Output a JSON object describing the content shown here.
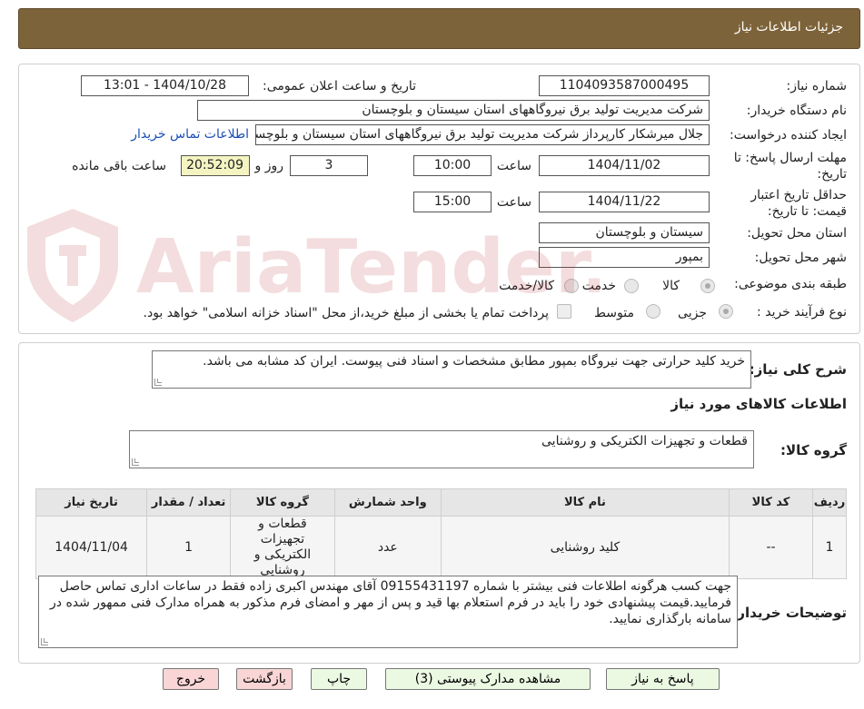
{
  "header": {
    "title": "جزئیات اطلاعات نیاز"
  },
  "need": {
    "number_label": "شماره نیاز:",
    "number_value": "1104093587000495",
    "announce_label": "تاریخ و ساعت اعلان عمومی:",
    "announce_value": "1404/10/28 - 13:01",
    "buyer_org_label": "نام دستگاه خریدار:",
    "buyer_org_value": "شرکت مدیریت تولید برق نیروگاههای استان سیستان و بلوچستان",
    "creator_label": "ایجاد کننده درخواست:",
    "creator_value": "جلال میرشکار کارپرداز شرکت مدیریت تولید برق نیروگاههای استان سیستان و بلوچستان",
    "contact_link": "اطلاعات تماس خریدار",
    "deadline_label_1": "مهلت ارسال پاسخ: تا",
    "deadline_label_2": "تاریخ:",
    "deadline_date": "1404/11/02",
    "time_label": "ساعت",
    "deadline_time": "10:00",
    "days_value": "3",
    "days_label": "روز و",
    "remaining_time": "20:52:09",
    "remaining_label": "ساعت باقی مانده",
    "validity_label_1": "حداقل تاریخ اعتبار",
    "validity_label_2": "قیمت: تا تاریخ:",
    "validity_date": "1404/11/22",
    "validity_time": "15:00",
    "province_label": "استان محل تحویل:",
    "province_value": "سیستان و بلوچستان",
    "city_label": "شهر محل تحویل:",
    "city_value": "بمپور",
    "category_label": "طبقه بندی موضوعی:",
    "category_options": [
      "کالا",
      "خدمت",
      "کالا/خدمت"
    ],
    "process_label": "نوع فرآیند خرید :",
    "process_options": [
      "جزیی",
      "متوسط"
    ],
    "treasury_text": "پرداخت تمام یا بخشی از مبلغ خرید،از محل \"اسناد خزانه اسلامی\" خواهد بود."
  },
  "description": {
    "label": "شرح کلی نیاز:",
    "value": "خرید کلید حرارتی جهت نیروگاه بمپور مطابق مشخصات و اسناد فنی پیوست. ایران کد مشابه می باشد."
  },
  "goods": {
    "section_title": "اطلاعات کالاهای مورد نیاز",
    "group_label": "گروه کالا:",
    "group_value": "قطعات و تجهیزات الکتریکی و روشنایی",
    "columns": [
      "ردیف",
      "کد کالا",
      "نام کالا",
      "واحد شمارش",
      "گروه کالا",
      "تعداد / مقدار",
      "تاریخ نیاز"
    ],
    "rows": [
      {
        "row": "1",
        "code": "--",
        "name": "کلید روشنایی",
        "unit": "عدد",
        "group": "قطعات و تجهیزات الکتریکی و روشنایی",
        "qty": "1",
        "date": "1404/11/04"
      }
    ]
  },
  "buyer_notes": {
    "label": "توضیحات خریدار:",
    "value": "جهت کسب هرگونه اطلاعات فنی بیشتر با شماره 09155431197 آقای مهندس اکبری زاده فقط در ساعات اداری تماس حاصل فرمایید.قیمت پیشنهادی خود را باید در فرم استعلام بها قید و پس از مهر و امضای فرم مذکور به همراه مدارک فنی ممهور شده در سامانه بارگذاری نمایید."
  },
  "buttons": {
    "reply": "پاسخ به نیاز",
    "attachments": "مشاهده مدارک پیوستی (3)",
    "print": "چاپ",
    "back": "بازگشت",
    "exit": "خروج"
  },
  "watermark": {
    "text": "AriaTender.neT"
  },
  "colors": {
    "header_bg": "#7d6339",
    "button_green": "#ebf9e3",
    "button_pink": "#f9d5d5",
    "timer_bg": "#f4f4c2",
    "link": "#1a4fb5",
    "watermark": "#b8323a"
  }
}
